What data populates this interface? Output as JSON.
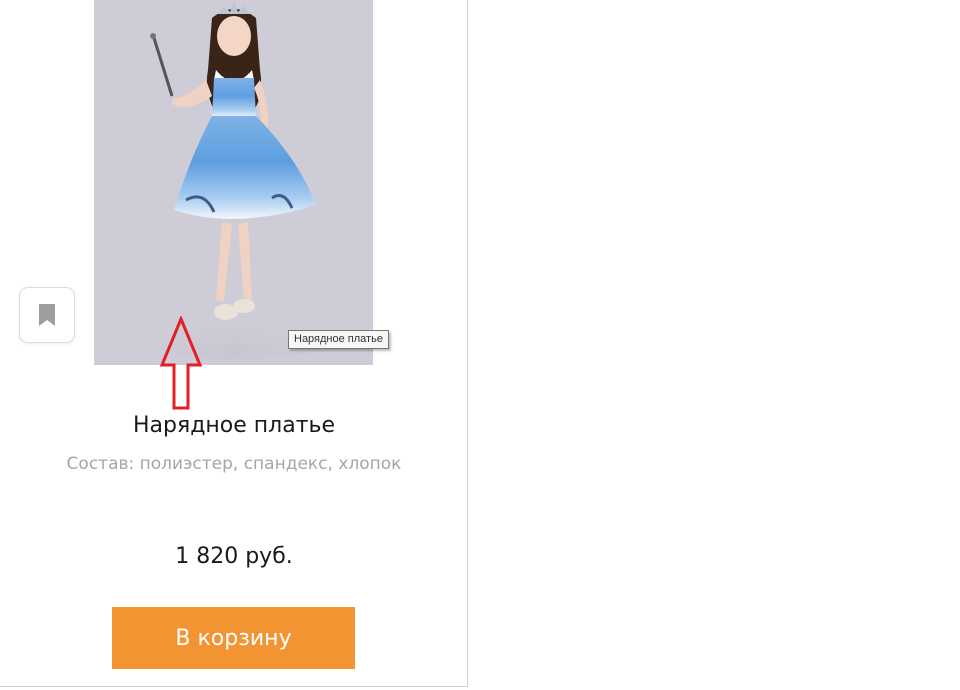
{
  "product": {
    "image_alt": "Нарядное платье",
    "title": "Нарядное платье",
    "composition": "Состав: полиэстер, спандекс, хлопок",
    "price": "1 820 руб.",
    "add_to_cart_label": "В корзину",
    "tooltip": "Нарядное платье"
  },
  "icons": {
    "bookmark": "bookmark-icon",
    "annotation_arrow": "arrow-up-icon"
  },
  "colors": {
    "button_bg": "#f39433",
    "button_text": "#ffffff",
    "title_text": "#1a1a1a",
    "composition_text": "#a6a6a6",
    "bookmark_icon": "#9e9e9e",
    "arrow": "#e31e24"
  }
}
